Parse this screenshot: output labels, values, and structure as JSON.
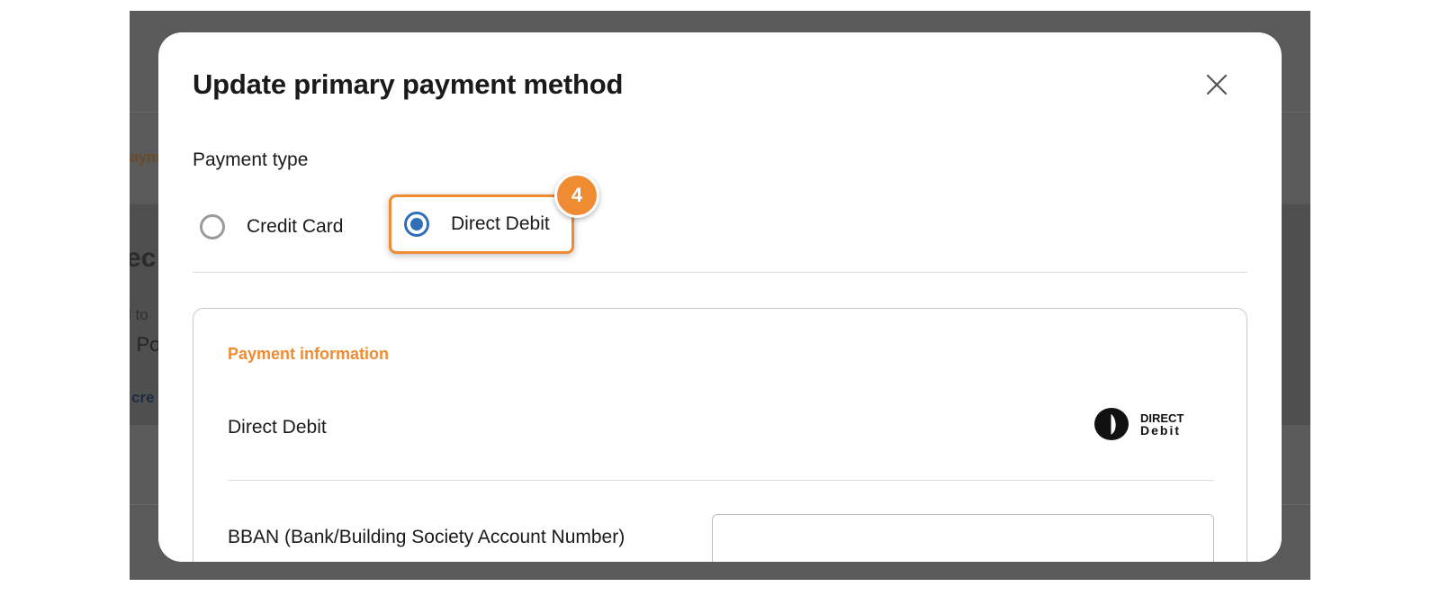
{
  "background": {
    "tab_fragment": "aym",
    "heading_fragment": "ec",
    "small_fragment": "l to",
    "line_fragment": "- Po",
    "link_fragment": "cre"
  },
  "modal": {
    "title": "Update primary payment method",
    "close_icon": "close-icon",
    "payment_type_label": "Payment type",
    "options": [
      {
        "label": "Credit Card",
        "selected": false
      },
      {
        "label": "Direct Debit",
        "selected": true
      }
    ],
    "step_badge": "4",
    "payment_info": {
      "heading": "Payment information",
      "method_label": "Direct Debit",
      "logo_text_top": "DIRECT",
      "logo_text_bottom": "Debit",
      "bban_label": "BBAN (Bank/Building Society Account Number)",
      "bban_value": "",
      "bban_placeholder": ""
    }
  },
  "colors": {
    "accent": "#ee8b33",
    "radio_selected": "#2f6fb5",
    "backdrop": "#4a4a4a"
  }
}
